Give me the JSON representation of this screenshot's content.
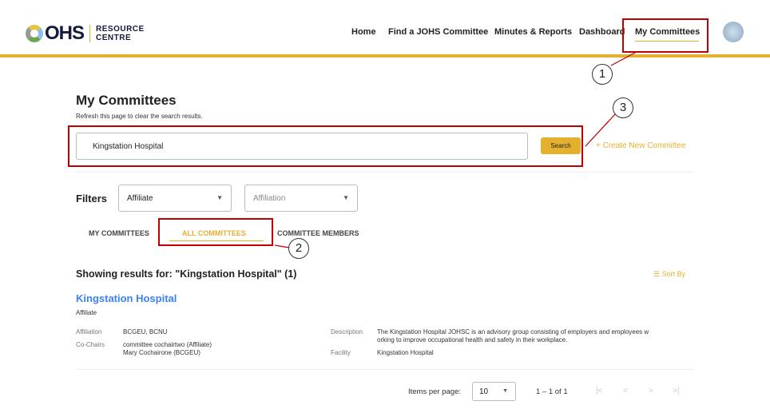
{
  "logo": {
    "mark": "OHS",
    "line1": "RESOURCE",
    "line2": "CENTRE"
  },
  "nav": [
    {
      "label": "Home"
    },
    {
      "label": "Find a JOHS Committee"
    },
    {
      "label": "Minutes & Reports"
    },
    {
      "label": "Dashboard"
    },
    {
      "label": "My Committees",
      "active": true
    }
  ],
  "page": {
    "title": "My Committees",
    "subtitle": "Refresh this page to clear the search results."
  },
  "search": {
    "value": "Kingstation Hospital",
    "button": "Search",
    "create": "+ Create New Committee"
  },
  "filters": {
    "label": "Filters",
    "affiliate": "Affiliate",
    "affiliation": "Affiliation"
  },
  "tabs": [
    {
      "label": "MY COMMITTEES"
    },
    {
      "label": "ALL COMMITTEES",
      "active": true
    },
    {
      "label": "COMMITTEE MEMBERS"
    }
  ],
  "results": {
    "heading": "Showing results for: \"Kingstation Hospital\" (1)",
    "sort": "Sort By"
  },
  "committee": {
    "name": "Kingstation Hospital",
    "type": "Affiliate",
    "affiliation_label": "Affiliation",
    "affiliation": "BCGEU, BCNU",
    "cochairs_label": "Co-Chairs",
    "cochair1": "committee cochairtwo (Affiliate)",
    "cochair2": "Mary Cochairone (BCGEU)",
    "description_label": "Description",
    "description1": "The Kingstation Hospital JOHSC is an advisory group consisting of employers and employees w",
    "description2": "orking to improve occupational health and safety in their workplace.",
    "facility_label": "Facility",
    "facility": "Kingstation Hospital"
  },
  "pagination": {
    "items_label": "Items per page:",
    "per_page": "10",
    "range": "1 – 1 of 1"
  },
  "callouts": [
    "1",
    "2",
    "3"
  ],
  "colors": {
    "accent": "#e4b12e",
    "link": "#3b82f6",
    "annotation": "#c00000"
  }
}
